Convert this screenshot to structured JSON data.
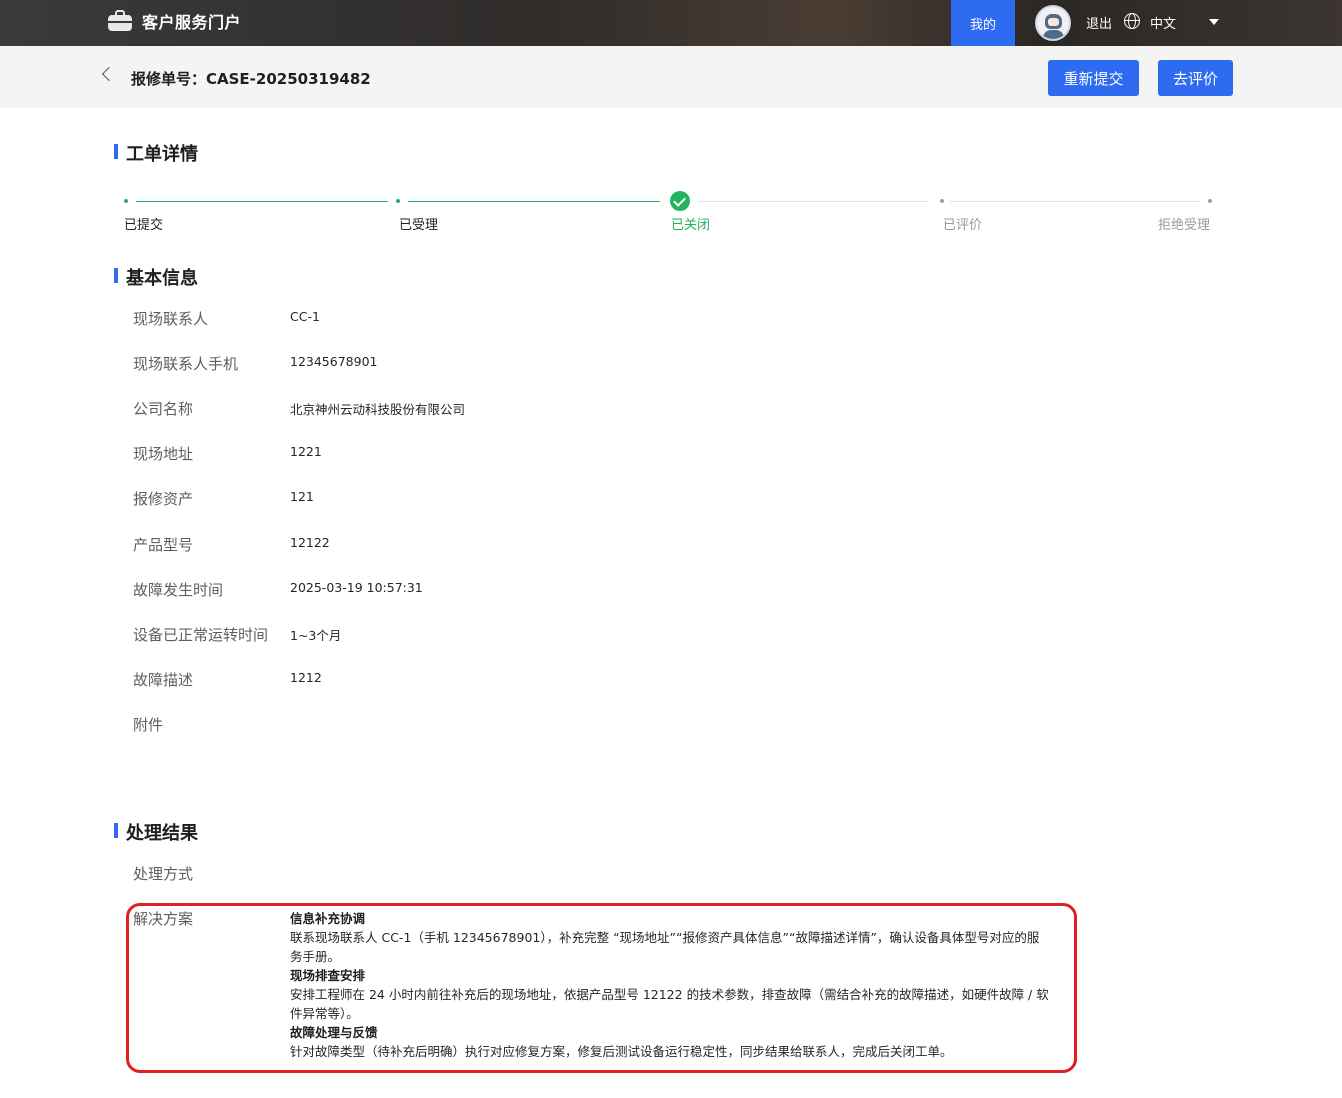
{
  "nav": {
    "title": "客户服务门户",
    "mine": "我的",
    "logout": "退出",
    "language": "中文"
  },
  "header": {
    "case_number": "报修单号：CASE-20250319482",
    "resubmit_label": "重新提交",
    "review_label": "去评价"
  },
  "sections": {
    "detail": "工单详情",
    "basic": "基本信息",
    "result": "处理结果"
  },
  "steps": [
    {
      "label": "已提交",
      "status": "done"
    },
    {
      "label": "已受理",
      "status": "done"
    },
    {
      "label": "已关闭",
      "status": "current"
    },
    {
      "label": "已评价",
      "status": "pending"
    },
    {
      "label": "拒绝受理",
      "status": "pending"
    }
  ],
  "fields": [
    {
      "label": "现场联系人",
      "value": "CC-1"
    },
    {
      "label": "现场联系人手机",
      "value": "12345678901"
    },
    {
      "label": "公司名称",
      "value": "北京神州云动科技股份有限公司"
    },
    {
      "label": "现场地址",
      "value": "1221"
    },
    {
      "label": "报修资产",
      "value": "121"
    },
    {
      "label": "产品型号",
      "value": "12122"
    },
    {
      "label": "故障发生时间",
      "value": "2025-03-19 10:57:31"
    },
    {
      "label": "设备已正常运转时间",
      "value": "1~3个月"
    },
    {
      "label": "故障描述",
      "value": "1212"
    },
    {
      "label": "附件",
      "value": ""
    }
  ],
  "result": {
    "method_label": "处理方式",
    "method_value": "",
    "solution_label": "解决方案",
    "solution": [
      {
        "heading": "信息补充协调",
        "text": "联系现场联系人 CC-1（手机 12345678901），补充完整 “现场地址”“报修资产具体信息”“故障描述详情”，确认设备具体型号对应的服务手册。"
      },
      {
        "heading": "现场排查安排",
        "text": "安排工程师在 24 小时内前往补充后的现场地址，依据产品型号 12122 的技术参数，排查故障（需结合补充的故障描述，如硬件故障 / 软件异常等）。"
      },
      {
        "heading": "故障处理与反馈",
        "text": "针对故障类型（待补充后明确）执行对应修复方案，修复后测试设备运行稳定性，同步结果给联系人，完成后关闭工单。"
      }
    ]
  },
  "colors": {
    "primary": "#2f6bf0",
    "success": "#22b35e",
    "highlight_border": "#e02020",
    "pending": "#9a9a9a"
  }
}
